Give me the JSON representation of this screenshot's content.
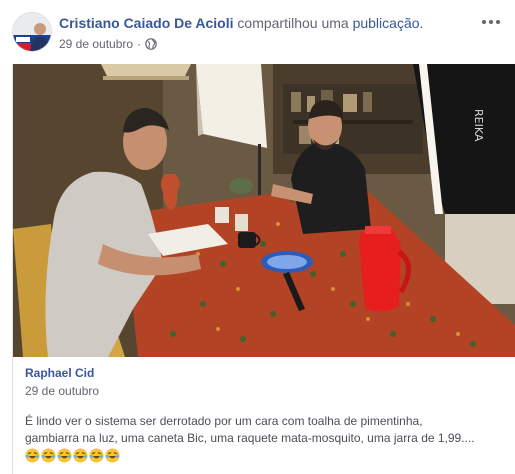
{
  "post": {
    "author": "Cristiano Caiado De Acioli",
    "action": "compartilhou uma",
    "link": "publicação.",
    "date": "29 de outubro",
    "separator": "·",
    "privacy_icon": "globe-icon",
    "more_icon": "more-options-icon"
  },
  "shared_post": {
    "media_type": "video",
    "author": "Raphael Cid",
    "date": "29 de outubro",
    "text": "É lindo ver o sistema ser derrotado por um cara com toalha de pimentinha,\ngambiarra na luz, uma caneta Bic, uma raquete mata-mosquito, uma jarra de 1,99....",
    "emojis": [
      "rolling-on-the-floor-laughing",
      "rolling-on-the-floor-laughing",
      "rolling-on-the-floor-laughing",
      "rolling-on-the-floor-laughing",
      "rolling-on-the-floor-laughing",
      "rolling-on-the-floor-laughing"
    ]
  },
  "colors": {
    "link_blue": "#385898",
    "meta_gray": "#616770",
    "text": "#1c1e21"
  }
}
